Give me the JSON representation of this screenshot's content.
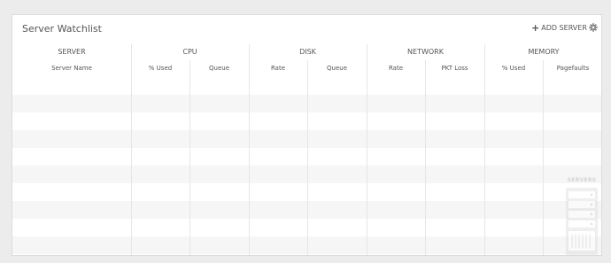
{
  "panel": {
    "title": "Server Watchlist",
    "add_server_label": "ADD SERVER"
  },
  "groups": [
    {
      "label": "SERVER"
    },
    {
      "label": "CPU"
    },
    {
      "label": "DISK"
    },
    {
      "label": "NETWORK"
    },
    {
      "label": "MEMORY"
    }
  ],
  "columns": [
    {
      "label": "Server Name"
    },
    {
      "label": "% Used"
    },
    {
      "label": "Queue"
    },
    {
      "label": "Rate"
    },
    {
      "label": "Queue"
    },
    {
      "label": "Rate"
    },
    {
      "label": "PKT Loss"
    },
    {
      "label": "% Used"
    },
    {
      "label": "Pagefaults"
    }
  ],
  "empty_state": {
    "label": "SERVERS",
    "icon": "server-rack-icon"
  },
  "colors": {
    "row_shade": "#f6f6f6",
    "text": "#555555"
  }
}
